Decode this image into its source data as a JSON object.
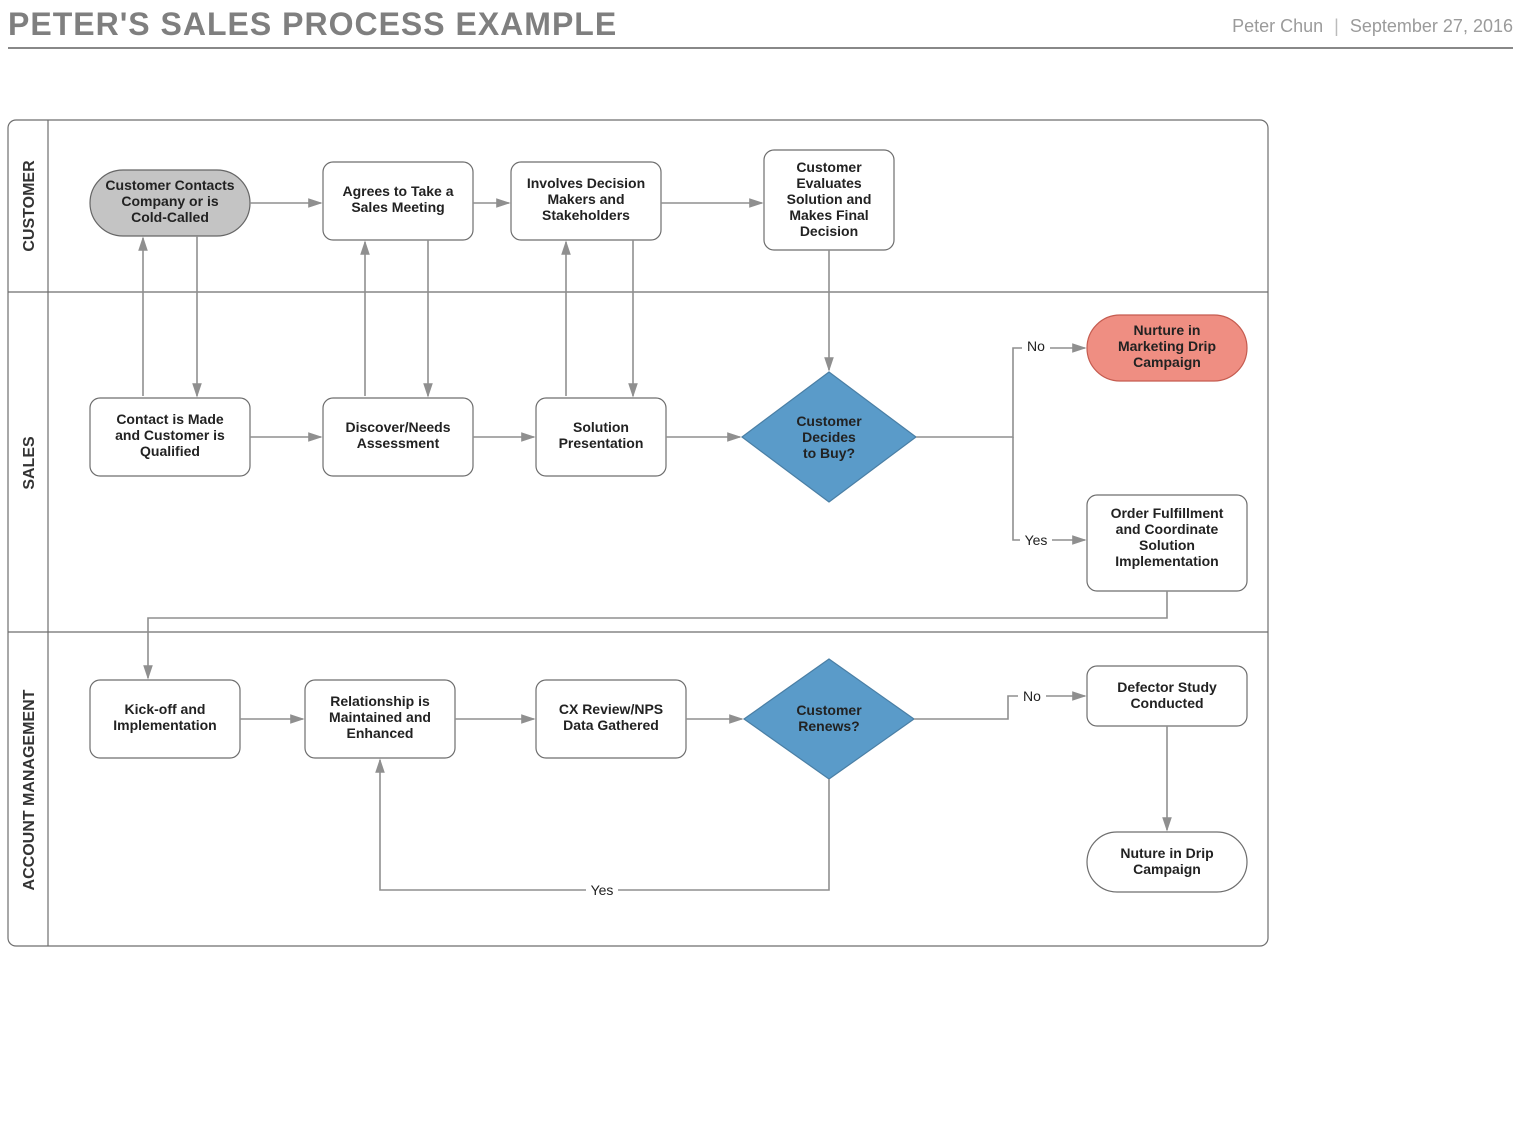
{
  "header": {
    "title": "PETER'S SALES PROCESS EXAMPLE",
    "author": "Peter Chun",
    "date": "September 27, 2016"
  },
  "lanes": {
    "customer": "CUSTOMER",
    "sales": "SALES",
    "account": "ACCOUNT MANAGEMENT"
  },
  "nodes": {
    "c1a": "Customer Contacts",
    "c1b": "Company or is",
    "c1c": "Cold-Called",
    "c2a": "Agrees to Take a",
    "c2b": "Sales Meeting",
    "c3a": "Involves Decision",
    "c3b": "Makers and",
    "c3c": "Stakeholders",
    "c4a": "Customer",
    "c4b": "Evaluates",
    "c4c": "Solution and",
    "c4d": "Makes Final",
    "c4e": "Decision",
    "s1a": "Contact is Made",
    "s1b": "and Customer is",
    "s1c": "Qualified",
    "s2a": "Discover/Needs",
    "s2b": "Assessment",
    "s3a": "Solution",
    "s3b": "Presentation",
    "s4a": "Customer",
    "s4b": "Decides",
    "s4c": "to Buy?",
    "s5a": "Nurture in",
    "s5b": "Marketing Drip",
    "s5c": "Campaign",
    "s6a": "Order Fulfillment",
    "s6b": "and Coordinate",
    "s6c": "Solution",
    "s6d": "Implementation",
    "a1a": "Kick-off and",
    "a1b": "Implementation",
    "a2a": "Relationship is",
    "a2b": "Maintained and",
    "a2c": "Enhanced",
    "a3a": "CX Review/NPS",
    "a3b": "Data Gathered",
    "a4a": "Customer",
    "a4b": "Renews?",
    "a5a": "Defector Study",
    "a5b": "Conducted",
    "a6a": "Nuture in Drip",
    "a6b": "Campaign"
  },
  "edges": {
    "no": "No",
    "yes": "Yes"
  }
}
